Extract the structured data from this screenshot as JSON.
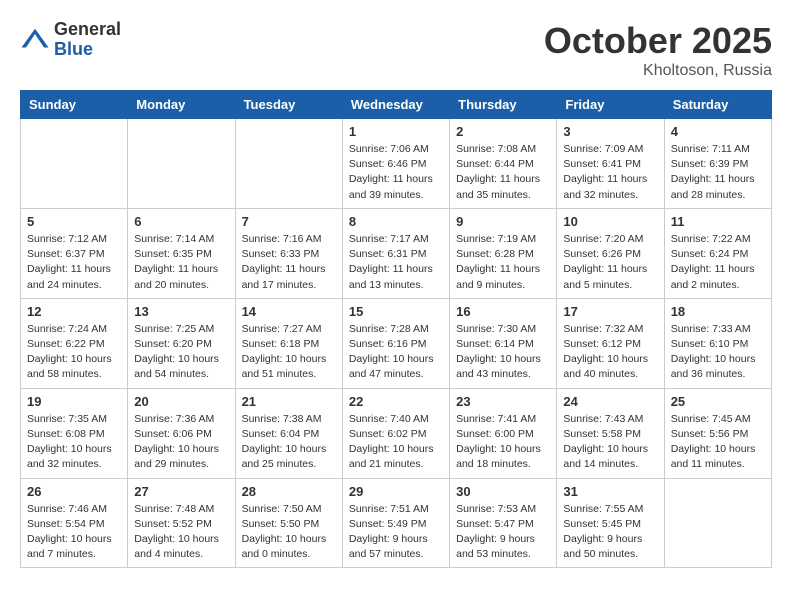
{
  "logo": {
    "general": "General",
    "blue": "Blue"
  },
  "title": "October 2025",
  "location": "Kholtoson, Russia",
  "days_of_week": [
    "Sunday",
    "Monday",
    "Tuesday",
    "Wednesday",
    "Thursday",
    "Friday",
    "Saturday"
  ],
  "weeks": [
    [
      {
        "day": "",
        "info": ""
      },
      {
        "day": "",
        "info": ""
      },
      {
        "day": "",
        "info": ""
      },
      {
        "day": "1",
        "info": "Sunrise: 7:06 AM\nSunset: 6:46 PM\nDaylight: 11 hours\nand 39 minutes."
      },
      {
        "day": "2",
        "info": "Sunrise: 7:08 AM\nSunset: 6:44 PM\nDaylight: 11 hours\nand 35 minutes."
      },
      {
        "day": "3",
        "info": "Sunrise: 7:09 AM\nSunset: 6:41 PM\nDaylight: 11 hours\nand 32 minutes."
      },
      {
        "day": "4",
        "info": "Sunrise: 7:11 AM\nSunset: 6:39 PM\nDaylight: 11 hours\nand 28 minutes."
      }
    ],
    [
      {
        "day": "5",
        "info": "Sunrise: 7:12 AM\nSunset: 6:37 PM\nDaylight: 11 hours\nand 24 minutes."
      },
      {
        "day": "6",
        "info": "Sunrise: 7:14 AM\nSunset: 6:35 PM\nDaylight: 11 hours\nand 20 minutes."
      },
      {
        "day": "7",
        "info": "Sunrise: 7:16 AM\nSunset: 6:33 PM\nDaylight: 11 hours\nand 17 minutes."
      },
      {
        "day": "8",
        "info": "Sunrise: 7:17 AM\nSunset: 6:31 PM\nDaylight: 11 hours\nand 13 minutes."
      },
      {
        "day": "9",
        "info": "Sunrise: 7:19 AM\nSunset: 6:28 PM\nDaylight: 11 hours\nand 9 minutes."
      },
      {
        "day": "10",
        "info": "Sunrise: 7:20 AM\nSunset: 6:26 PM\nDaylight: 11 hours\nand 5 minutes."
      },
      {
        "day": "11",
        "info": "Sunrise: 7:22 AM\nSunset: 6:24 PM\nDaylight: 11 hours\nand 2 minutes."
      }
    ],
    [
      {
        "day": "12",
        "info": "Sunrise: 7:24 AM\nSunset: 6:22 PM\nDaylight: 10 hours\nand 58 minutes."
      },
      {
        "day": "13",
        "info": "Sunrise: 7:25 AM\nSunset: 6:20 PM\nDaylight: 10 hours\nand 54 minutes."
      },
      {
        "day": "14",
        "info": "Sunrise: 7:27 AM\nSunset: 6:18 PM\nDaylight: 10 hours\nand 51 minutes."
      },
      {
        "day": "15",
        "info": "Sunrise: 7:28 AM\nSunset: 6:16 PM\nDaylight: 10 hours\nand 47 minutes."
      },
      {
        "day": "16",
        "info": "Sunrise: 7:30 AM\nSunset: 6:14 PM\nDaylight: 10 hours\nand 43 minutes."
      },
      {
        "day": "17",
        "info": "Sunrise: 7:32 AM\nSunset: 6:12 PM\nDaylight: 10 hours\nand 40 minutes."
      },
      {
        "day": "18",
        "info": "Sunrise: 7:33 AM\nSunset: 6:10 PM\nDaylight: 10 hours\nand 36 minutes."
      }
    ],
    [
      {
        "day": "19",
        "info": "Sunrise: 7:35 AM\nSunset: 6:08 PM\nDaylight: 10 hours\nand 32 minutes."
      },
      {
        "day": "20",
        "info": "Sunrise: 7:36 AM\nSunset: 6:06 PM\nDaylight: 10 hours\nand 29 minutes."
      },
      {
        "day": "21",
        "info": "Sunrise: 7:38 AM\nSunset: 6:04 PM\nDaylight: 10 hours\nand 25 minutes."
      },
      {
        "day": "22",
        "info": "Sunrise: 7:40 AM\nSunset: 6:02 PM\nDaylight: 10 hours\nand 21 minutes."
      },
      {
        "day": "23",
        "info": "Sunrise: 7:41 AM\nSunset: 6:00 PM\nDaylight: 10 hours\nand 18 minutes."
      },
      {
        "day": "24",
        "info": "Sunrise: 7:43 AM\nSunset: 5:58 PM\nDaylight: 10 hours\nand 14 minutes."
      },
      {
        "day": "25",
        "info": "Sunrise: 7:45 AM\nSunset: 5:56 PM\nDaylight: 10 hours\nand 11 minutes."
      }
    ],
    [
      {
        "day": "26",
        "info": "Sunrise: 7:46 AM\nSunset: 5:54 PM\nDaylight: 10 hours\nand 7 minutes."
      },
      {
        "day": "27",
        "info": "Sunrise: 7:48 AM\nSunset: 5:52 PM\nDaylight: 10 hours\nand 4 minutes."
      },
      {
        "day": "28",
        "info": "Sunrise: 7:50 AM\nSunset: 5:50 PM\nDaylight: 10 hours\nand 0 minutes."
      },
      {
        "day": "29",
        "info": "Sunrise: 7:51 AM\nSunset: 5:49 PM\nDaylight: 9 hours\nand 57 minutes."
      },
      {
        "day": "30",
        "info": "Sunrise: 7:53 AM\nSunset: 5:47 PM\nDaylight: 9 hours\nand 53 minutes."
      },
      {
        "day": "31",
        "info": "Sunrise: 7:55 AM\nSunset: 5:45 PM\nDaylight: 9 hours\nand 50 minutes."
      },
      {
        "day": "",
        "info": ""
      }
    ]
  ]
}
